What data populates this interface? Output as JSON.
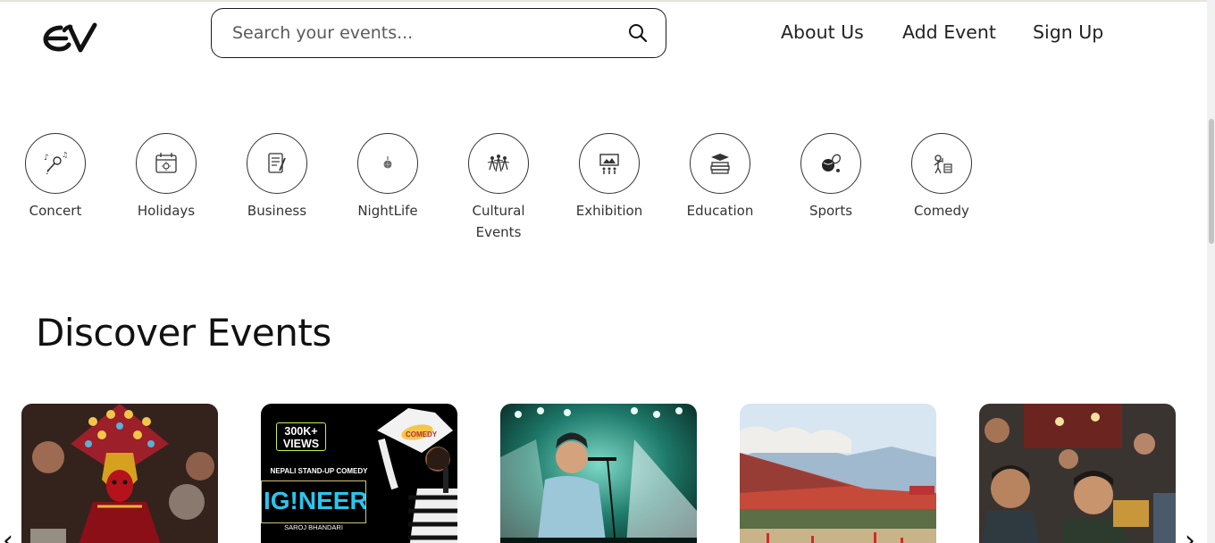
{
  "header": {
    "logo_text": "EV",
    "search_placeholder": "Search your events...",
    "nav": [
      "About Us",
      "Add Event",
      "Sign Up"
    ]
  },
  "categories": [
    {
      "label": "Concert",
      "icon": "microphone-music-icon"
    },
    {
      "label": "Holidays",
      "icon": "calendar-sun-icon"
    },
    {
      "label": "Business",
      "icon": "document-pen-icon"
    },
    {
      "label": "NightLife",
      "icon": "disco-ball-icon"
    },
    {
      "label": "Cultural Events",
      "icon": "cultural-dancers-icon"
    },
    {
      "label": "Exhibition",
      "icon": "gallery-board-icon"
    },
    {
      "label": "Education",
      "icon": "books-graduation-icon"
    },
    {
      "label": "Sports",
      "icon": "sports-balls-icon"
    },
    {
      "label": "Comedy",
      "icon": "comedian-stage-icon"
    }
  ],
  "discover": {
    "title": "Discover Events",
    "cards": [
      {
        "name": "cultural-festival-mask",
        "badge": "",
        "subtitle": "",
        "headline": ""
      },
      {
        "name": "standup-comedy-poster",
        "badge": "300K+ VIEWS",
        "subtitle": "NEPALI STAND-UP COMEDY",
        "headline": "IG!NEER",
        "credit": "SAROJ BHANDARI",
        "tag": "COMEDY"
      },
      {
        "name": "concert-singer",
        "badge": "",
        "subtitle": "",
        "headline": ""
      },
      {
        "name": "stadium-football",
        "badge": "",
        "subtitle": "",
        "headline": ""
      },
      {
        "name": "comedy-audience",
        "badge": "",
        "subtitle": "",
        "headline": ""
      }
    ]
  },
  "colors": {
    "accent": "#1a1a1a",
    "text": "#222222",
    "scroll_thumb": "#c4c4c4"
  }
}
